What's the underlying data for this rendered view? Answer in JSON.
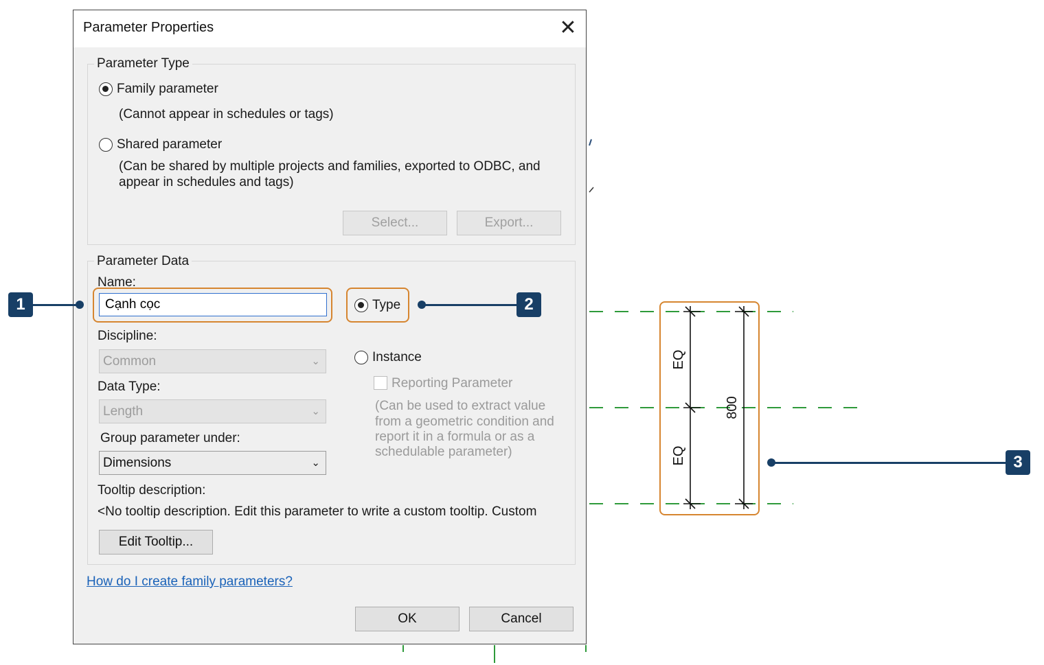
{
  "dialog": {
    "title": "Parameter Properties",
    "close_glyph": "✕"
  },
  "parameter_type": {
    "legend": "Parameter Type",
    "family_label": "Family parameter",
    "family_note": "(Cannot appear in schedules or tags)",
    "shared_label": "Shared parameter",
    "shared_note_1": "(Can be shared by multiple projects and families, exported to ODBC, and",
    "shared_note_2": "appear in schedules and tags)",
    "select_button": "Select...",
    "export_button": "Export...",
    "selected": "family"
  },
  "parameter_data": {
    "legend": "Parameter Data",
    "name_label": "Name:",
    "name_value": "Cạnh cọc",
    "discipline_label": "Discipline:",
    "discipline_value": "Common",
    "data_type_label": "Data Type:",
    "data_type_value": "Length",
    "group_label": "Group parameter under:",
    "group_value": "Dimensions",
    "type_label": "Type",
    "instance_label": "Instance",
    "reporting_label": "Reporting Parameter",
    "reporting_note": [
      "(Can be used to extract value",
      "from a geometric condition and",
      "report it in a formula or as a",
      "schedulable parameter)"
    ],
    "tooltip_label": "Tooltip description:",
    "tooltip_text": "<No tooltip description. Edit this parameter to write a custom tooltip. Custom",
    "edit_tooltip_button": "Edit Tooltip...",
    "selected": "type"
  },
  "help_link": "How do I create family parameters?",
  "ok_button": "OK",
  "cancel_button": "Cancel",
  "callouts": [
    "1",
    "2",
    "3"
  ],
  "drawing": {
    "eq_top": "EQ",
    "eq_bottom": "EQ",
    "dimension": "800"
  },
  "colors": {
    "callout_orange": "#d6852f",
    "badge_navy": "#183f66",
    "ref_plane_green": "#2e9a3a",
    "link_blue": "#1a62b8"
  }
}
